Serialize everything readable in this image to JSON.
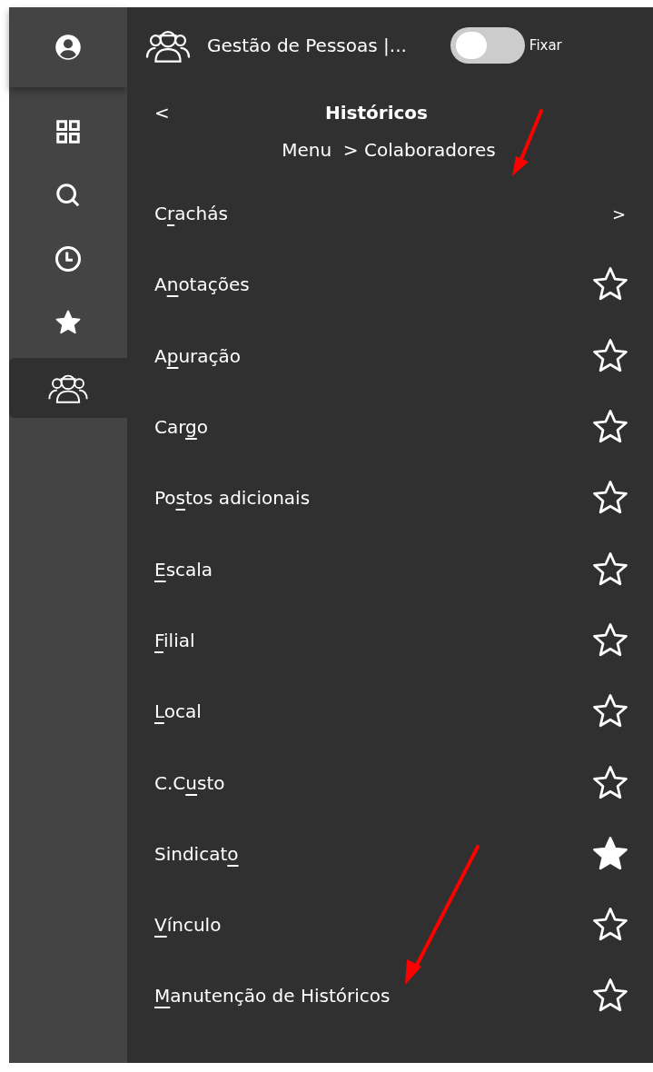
{
  "rail": [
    {
      "kind": "grid",
      "selected": false
    },
    {
      "kind": "search",
      "selected": false
    },
    {
      "kind": "clock",
      "selected": false
    },
    {
      "kind": "star",
      "selected": false
    },
    {
      "kind": "people",
      "selected": true
    }
  ],
  "header": {
    "title": "Gestão de Pessoas |...",
    "pin_toggle": {
      "label": "Fixar",
      "on": false
    }
  },
  "panel": {
    "back": "<",
    "title": "Históricos",
    "breadcrumb": "Menu  > Colaboradores"
  },
  "items": [
    {
      "kind": "submenu",
      "before": "C",
      "key": "r",
      "after": "achás",
      "arrow": ">"
    },
    {
      "kind": "favorite",
      "before": "A",
      "key": "n",
      "after": "otações",
      "favorite": false
    },
    {
      "kind": "favorite",
      "before": "A",
      "key": "p",
      "after": "uração",
      "favorite": false
    },
    {
      "kind": "favorite",
      "before": "Car",
      "key": "g",
      "after": "o",
      "favorite": false
    },
    {
      "kind": "favorite",
      "before": "Po",
      "key": "s",
      "after": "tos adicionais",
      "favorite": false
    },
    {
      "kind": "favorite",
      "key": "E",
      "after": "scala",
      "favorite": false
    },
    {
      "kind": "favorite",
      "key": "F",
      "after": "ilial",
      "favorite": false
    },
    {
      "kind": "favorite",
      "key": "L",
      "after": "ocal",
      "favorite": false
    },
    {
      "kind": "favorite",
      "before": "C.C",
      "key": "u",
      "after": "sto",
      "favorite": false
    },
    {
      "kind": "favorite",
      "before": "Sindicat",
      "key": "o",
      "favorite": true
    },
    {
      "kind": "favorite",
      "key": "V",
      "after": "ínculo",
      "favorite": false
    },
    {
      "kind": "favorite",
      "key": "M",
      "after": "anutenção de Históricos",
      "favorite": false
    }
  ]
}
